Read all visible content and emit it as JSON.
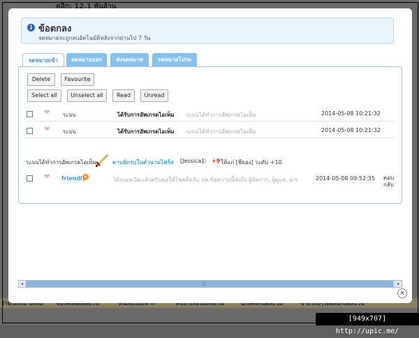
{
  "background": {
    "top_text": "คลิก: 12.1 พันล้าน",
    "bottom_items": [
      "ร้านไอเท็ม Gold",
      "ของพิเศษแต่ละวัน",
      "ค้นเลยน้องหาก",
      "ค้นหาเพื่อนแต่ละวัน",
      "มีกลคลิกแต่ละวัน",
      "ขายใหม่ๆได้ผลแก่แต่ละวัน"
    ]
  },
  "notice": {
    "icon": "info-icon",
    "title": "ข้อตกลง",
    "subtitle": "จดหมายจะถูกลบอัตโนมัติหลังจากผ่านไป 7 วัน"
  },
  "tabs": [
    {
      "label": "จดหมายเข้า",
      "active": true
    },
    {
      "label": "จดหมายออก",
      "active": false
    },
    {
      "label": "ส่งจดหมาย",
      "active": false
    },
    {
      "label": "จดหมายโปรด",
      "active": false
    }
  ],
  "toolbar": {
    "delete_label": "Delete",
    "favourite_label": "Favourite",
    "select_all_label": "Select all",
    "unselect_all_label": "Unselect all",
    "read_label": "Read",
    "unread_label": "Unread"
  },
  "messages": [
    {
      "sender": "ระบบ",
      "subject": "ได้รับการอัพเกรดไอเท็ม",
      "preview": "ระบบได้ทำการอัพเกรดไอเท็ม",
      "date": "2014-05-08 10:21:32"
    },
    {
      "sender": "ระบบ",
      "subject": "ได้รับการอัพเกรดไอเท็ม",
      "preview": "ระบบได้ทำการอัพเกรดไอเท็ม",
      "date": "2014-05-08 10:21:32"
    }
  ],
  "upgrade_line": {
    "prefix": "ระบบได้ทำการอัพเกรดไอเท็ม",
    "item_name": "ดาบนักรบในตำนานไฟร์ส",
    "owner": "[Jessica]",
    "plus": "+9",
    "rest": "ให้แก่ [ชียอง] ระดับ +10"
  },
  "message3": {
    "sender": "friendly",
    "preview": "ได้เบอลเปิดแล้วครับขอให้โชคดีครับ ปล.ข้อความนี้ส่งถึง ผู้จัดการ, ผู้ดูแล, มาเ",
    "date": "2014-05-08 09:52:35",
    "reply_label": "ตอบกลับ"
  },
  "close_label": "×",
  "watermark": "[949x707] http://upic.me/",
  "colors": {
    "tab_bg": "#86c2ec",
    "accent": "#3d8fd0",
    "notice_bg": "#eaf4fc"
  }
}
